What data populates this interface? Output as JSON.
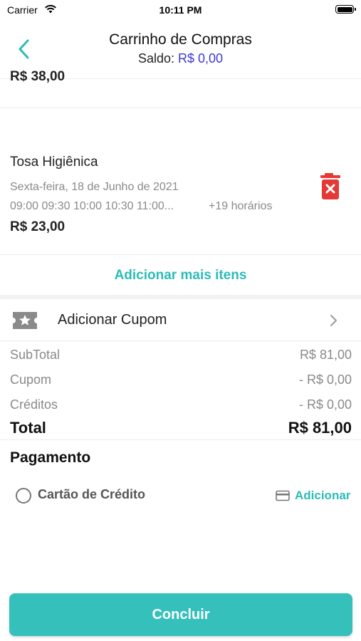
{
  "status_bar": {
    "carrier": "Carrier",
    "time": "10:11 PM"
  },
  "header": {
    "title": "Carrinho de Compras",
    "balance_label": "Saldo:",
    "balance_value": "R$ 0,00"
  },
  "cart": {
    "previous_item_price": "R$ 38,00",
    "items": [
      {
        "name": "Tosa Higiênica",
        "date": "Sexta-feira, 18 de Junho de 2021",
        "times": "09:00 09:30 10:00 10:30 11:00...",
        "more_times": "+19 horários",
        "price": "R$ 23,00"
      }
    ],
    "add_more_label": "Adicionar mais itens"
  },
  "coupon": {
    "label": "Adicionar Cupom"
  },
  "summary": {
    "subtotal_label": "SubTotal",
    "subtotal_value": "R$ 81,00",
    "coupon_label": "Cupom",
    "coupon_value": "- R$ 0,00",
    "credits_label": "Créditos",
    "credits_value": "- R$ 0,00",
    "total_label": "Total",
    "total_value": "R$ 81,00"
  },
  "payment": {
    "title": "Pagamento",
    "option_label": "Cartão de Crédito",
    "add_label": "Adicionar"
  },
  "actions": {
    "conclude_label": "Concluir"
  },
  "colors": {
    "accent": "#2bbcb8",
    "button": "#35c0bc",
    "balance": "#3b3bd6",
    "delete": "#e53935"
  }
}
